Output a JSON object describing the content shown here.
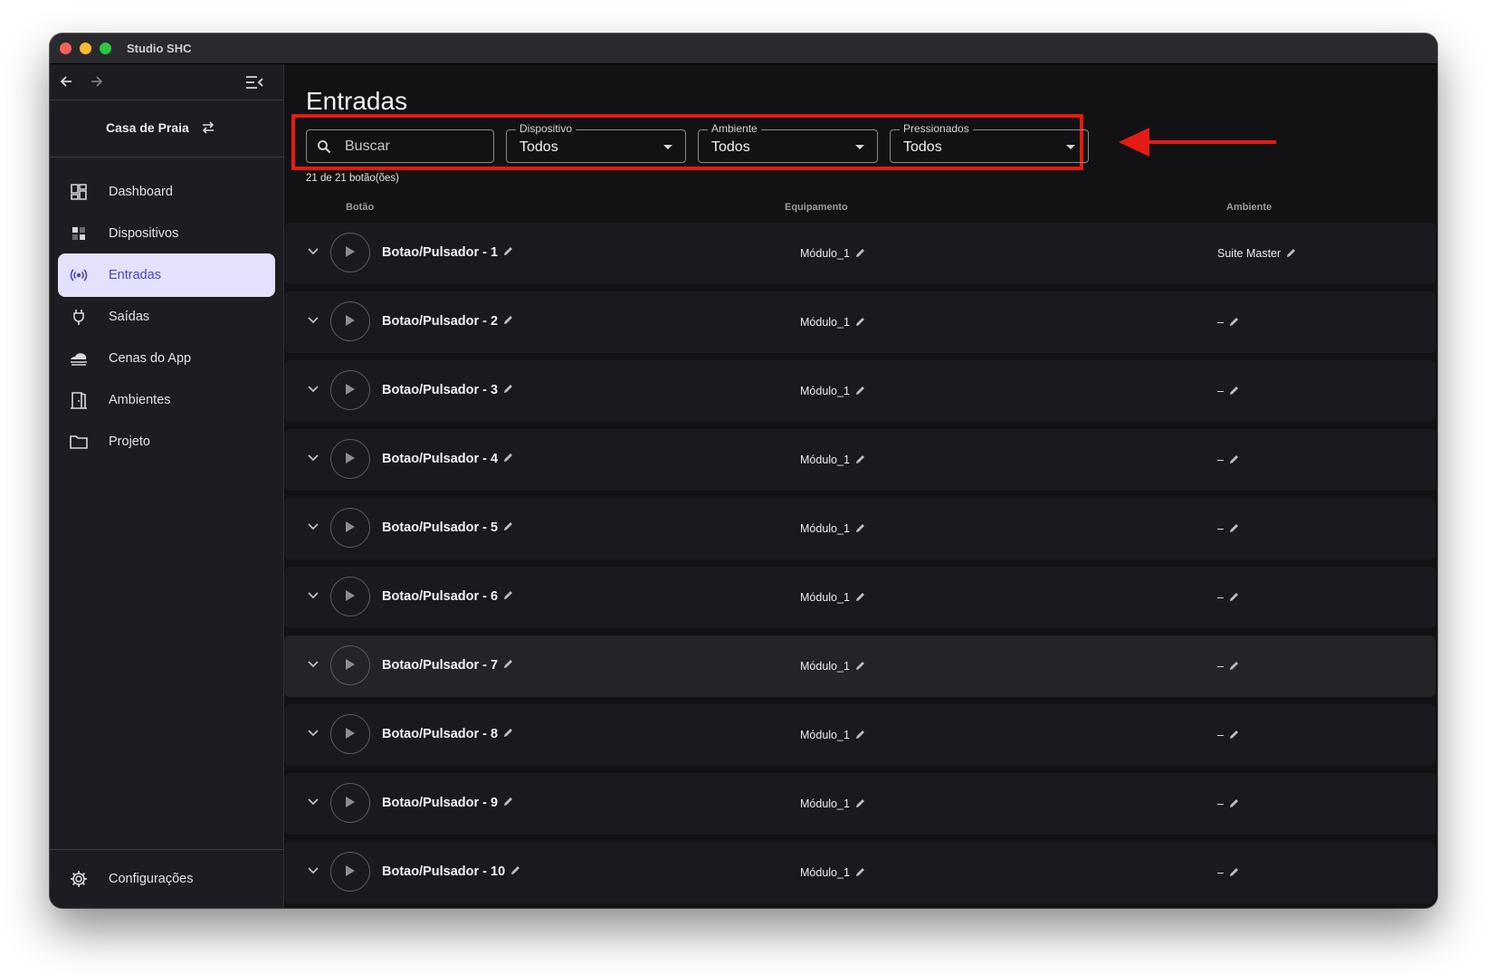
{
  "window": {
    "title": "Studio SHC"
  },
  "sidebar": {
    "project_name": "Casa de Praia",
    "items": [
      {
        "label": "Dashboard",
        "icon": "dashboard-icon",
        "active": false
      },
      {
        "label": "Dispositivos",
        "icon": "devices-icon",
        "active": false
      },
      {
        "label": "Entradas",
        "icon": "inputs-radio-icon",
        "active": true
      },
      {
        "label": "Saídas",
        "icon": "plug-icon",
        "active": false
      },
      {
        "label": "Cenas do App",
        "icon": "cloud-scene-icon",
        "active": false
      },
      {
        "label": "Ambientes",
        "icon": "door-icon",
        "active": false
      },
      {
        "label": "Projeto",
        "icon": "folder-icon",
        "active": false
      }
    ],
    "settings_label": "Configurações"
  },
  "main": {
    "title": "Entradas",
    "search": {
      "placeholder": "Buscar"
    },
    "filters": [
      {
        "label": "Dispositivo",
        "value": "Todos"
      },
      {
        "label": "Ambiente",
        "value": "Todos"
      },
      {
        "label": "Pressionados",
        "value": "Todos"
      }
    ],
    "count_text": "21 de 21 botão(ões)",
    "columns": {
      "button": "Botão",
      "equipment": "Equipamento",
      "environment": "Ambiente"
    },
    "rows": [
      {
        "name": "Botao/Pulsador - 1",
        "equipment": "Módulo_1",
        "environment": "Suite Master"
      },
      {
        "name": "Botao/Pulsador - 2",
        "equipment": "Módulo_1",
        "environment": "–"
      },
      {
        "name": "Botao/Pulsador - 3",
        "equipment": "Módulo_1",
        "environment": "–"
      },
      {
        "name": "Botao/Pulsador - 4",
        "equipment": "Módulo_1",
        "environment": "–"
      },
      {
        "name": "Botao/Pulsador - 5",
        "equipment": "Módulo_1",
        "environment": "–"
      },
      {
        "name": "Botao/Pulsador - 6",
        "equipment": "Módulo_1",
        "environment": "–"
      },
      {
        "name": "Botao/Pulsador - 7",
        "equipment": "Módulo_1",
        "environment": "–"
      },
      {
        "name": "Botao/Pulsador - 8",
        "equipment": "Módulo_1",
        "environment": "–"
      },
      {
        "name": "Botao/Pulsador - 9",
        "equipment": "Módulo_1",
        "environment": "–"
      },
      {
        "name": "Botao/Pulsador - 10",
        "equipment": "Módulo_1",
        "environment": "–"
      }
    ]
  },
  "colors": {
    "accent": "#4e44c8",
    "active_bg": "#e3e1fb",
    "highlight": "#e41b13"
  }
}
